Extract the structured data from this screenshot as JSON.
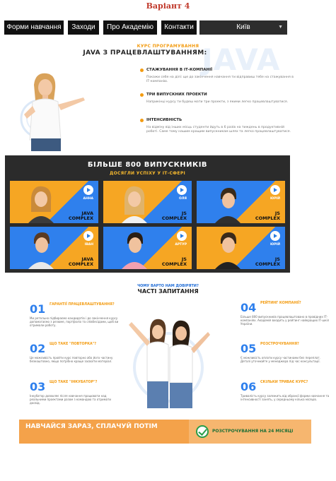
{
  "variant": "Варіант 4",
  "nav": {
    "items": [
      "Форми навчання",
      "Заходи",
      "Про Академію",
      "Контакти"
    ],
    "city": "Київ"
  },
  "course": {
    "eyebrow": "КУРС ПРОГРАМУВАННЯ",
    "title": "JAVA З ПРАЦЕВЛАШТУВАННЯМ:",
    "watermark": "JAVA",
    "features": [
      {
        "title": "СТАЖУВАННЯ В ІТ-КОМПАНІЇ",
        "text": "Покажи себе на ділі: ще до закінчення навчання ти відправиш тебе на стажування в ІТ-компанію."
      },
      {
        "title": "ТРИ ВИПУСКНИХ ПРОЕКТИ",
        "text": "Наприкінці курсу ти будеш мати три проекти, з якими легко працевлаштуватися."
      },
      {
        "title": "ІНТЕНСИВНІСТЬ",
        "text": "На відміну від інших місць студенти йдуть в 6 разів на тиждень в продуктивній роботі. Саме тому нашим кращим випускникам шлях та легко працевлаштуватися."
      }
    ]
  },
  "graduates": {
    "title": "БІЛЬШЕ 800 ВИПУСКНИКІВ",
    "subtitle": "ДОСЯГЛИ УСПІХУ У ІТ-СФЕРІ",
    "cards": [
      {
        "name": "АННА",
        "course": [
          "JAVA",
          "COMPLEX"
        ]
      },
      {
        "name": "ОЛЯ",
        "course": [
          "JS",
          "COMPLEX"
        ]
      },
      {
        "name": "ЮРІЙ",
        "course": [
          "JS",
          "COMPLEX"
        ]
      },
      {
        "name": "ІВАН",
        "course": [
          "JAVA",
          "COMPLEX"
        ]
      },
      {
        "name": "АРТУР",
        "course": [
          "JS",
          "COMPLEX"
        ]
      },
      {
        "name": "ЮРІЙ",
        "course": [
          "JS",
          "COMPLEX"
        ]
      }
    ]
  },
  "faq": {
    "eyebrow": "ЧОМУ ВАРТО НАМ ДОВІРЯТИ?",
    "title": "ЧАСТІ ЗАПИТАННЯ",
    "items": [
      {
        "num": "01",
        "q": "ГАРАНТІЇ ПРАЦЕВЛАШТУВАННЯ?",
        "a": "Ми ретельно підбираємо кандидатів і до закінчення курсу допомагаємо з резюме, портфоліо та співбесідами, щоб ви отримали роботу."
      },
      {
        "num": "02",
        "q": "ЩО ТАКЕ \"ПОВТОРКА\"?",
        "a": "Це можливість пройти курс повторно або його частину безкоштовно, якщо потрібно краще засвоїти матеріал."
      },
      {
        "num": "03",
        "q": "ЩО ТАКЕ \"ІНКУБАТОР\"?",
        "a": "Інкубатор дозволяє після навчання працювати над реальними проектами разом з командою та отримати досвід."
      },
      {
        "num": "04",
        "q": "РЕЙТИНГ КОМПАНІЇ?",
        "a": "Більше 800 випускників працевлаштовано в провідних ІТ-компаніях. Академія входить у рейтинг найкращих ІТ-шкіл України."
      },
      {
        "num": "05",
        "q": "РОЗСТРОЧУВАННЯ?",
        "a": "Є можливість оплати курсу частинами без переплат. Деталі уточнюйте у менеджера під час консультації."
      },
      {
        "num": "06",
        "q": "СКІЛЬКИ ТРИВАЄ КУРС?",
        "a": "Тривалість курсу залежить від обраної форми навчання та інтенсивності занять, у середньому кілька місяців."
      }
    ]
  },
  "banner": {
    "left": "НАВЧАЙСЯ ЗАРАЗ, СПЛАЧУЙ ПОТІМ",
    "right": "РОЗСТРОЧУВАННЯ НА 24 МІСЯЦІ"
  },
  "colors": {
    "accent": "#f39c12",
    "blue": "#2f80ed",
    "dark": "#111111"
  }
}
